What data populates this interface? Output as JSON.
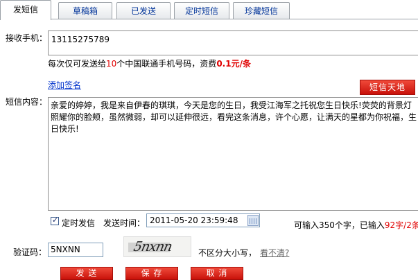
{
  "tabs": [
    {
      "label": "发短信",
      "active": true
    },
    {
      "label": "草稿箱",
      "active": false
    },
    {
      "label": "已发送",
      "active": false
    },
    {
      "label": "定时短信",
      "active": false
    },
    {
      "label": "珍藏短信",
      "active": false
    }
  ],
  "recipient": {
    "label": "接收手机：",
    "value": "13115275789"
  },
  "hint": {
    "prefix": "每次仅可发送给",
    "count": "10",
    "middle": "个中国联通手机号码，资费",
    "price": "0.1元/条"
  },
  "add_signature_link": "添加签名",
  "sms_world_button": "短信天地",
  "message": {
    "label": "短信内容：",
    "text": "亲爱的婷婷，我是来自伊春的琪琪，今天是您的生日，我受江海军之托祝您生日快乐!荧荧的背景灯照耀你的脸颊，虽然微弱，却可以延伸很远，看完这条消息，许个心愿，让满天的星都为你祝福，生日快乐!"
  },
  "schedule": {
    "checkbox_label": "定时发信",
    "checked": true,
    "time_label": "发送时间：",
    "time_value": "2011-05-20 23:59:48"
  },
  "counter": {
    "prefix": "可输入350个字，已输入",
    "count_text": "92字/2条"
  },
  "captcha": {
    "label": "验证码：",
    "value": "5NXNN",
    "image_text": "5nxnn",
    "case_note": "不区分大小写，",
    "unclear_link": "看不清?"
  },
  "buttons": {
    "send": "发 送",
    "save": "保 存",
    "cancel": "取 消"
  },
  "colors": {
    "accent_red": "#e00000",
    "button_red": "#d42415",
    "link_blue": "#0033cc"
  }
}
